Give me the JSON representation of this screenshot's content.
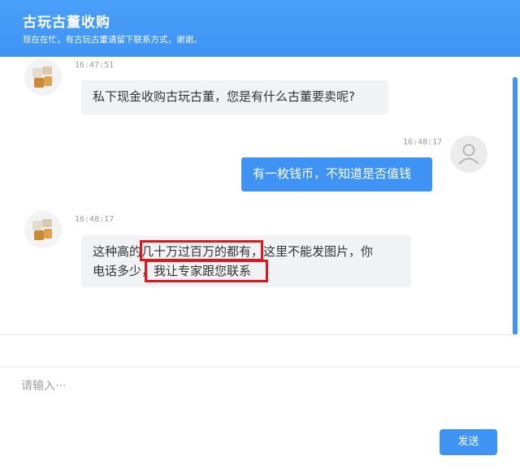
{
  "header": {
    "title": "古玩古董收购",
    "subtitle": "现在在忙，有古玩古董请留下联系方式，谢谢。"
  },
  "messages": [
    {
      "sender": "agent",
      "time": "16:47:51",
      "lines": [
        "私下现金收购古玩古董，您是有什么古董要卖呢?"
      ]
    },
    {
      "sender": "user",
      "time": "16:48:17",
      "lines": [
        "有一枚钱币，不知道是否值钱"
      ]
    },
    {
      "sender": "agent",
      "time": "16:48:17",
      "lines": [
        "这种高的几十万过百万的都有，这里不能发图片，你",
        "电话多少，我让专家跟您联系"
      ]
    }
  ],
  "input": {
    "placeholder": "请输入···"
  },
  "send_button": {
    "label": "发送"
  },
  "colors": {
    "accent": "#3f93f4",
    "highlight_box": "#e3141b",
    "bubble_left": "#f1f2f4"
  },
  "icons": {
    "agent_avatar": "pixelated-avatar-icon",
    "user_avatar": "user-avatar-icon"
  }
}
